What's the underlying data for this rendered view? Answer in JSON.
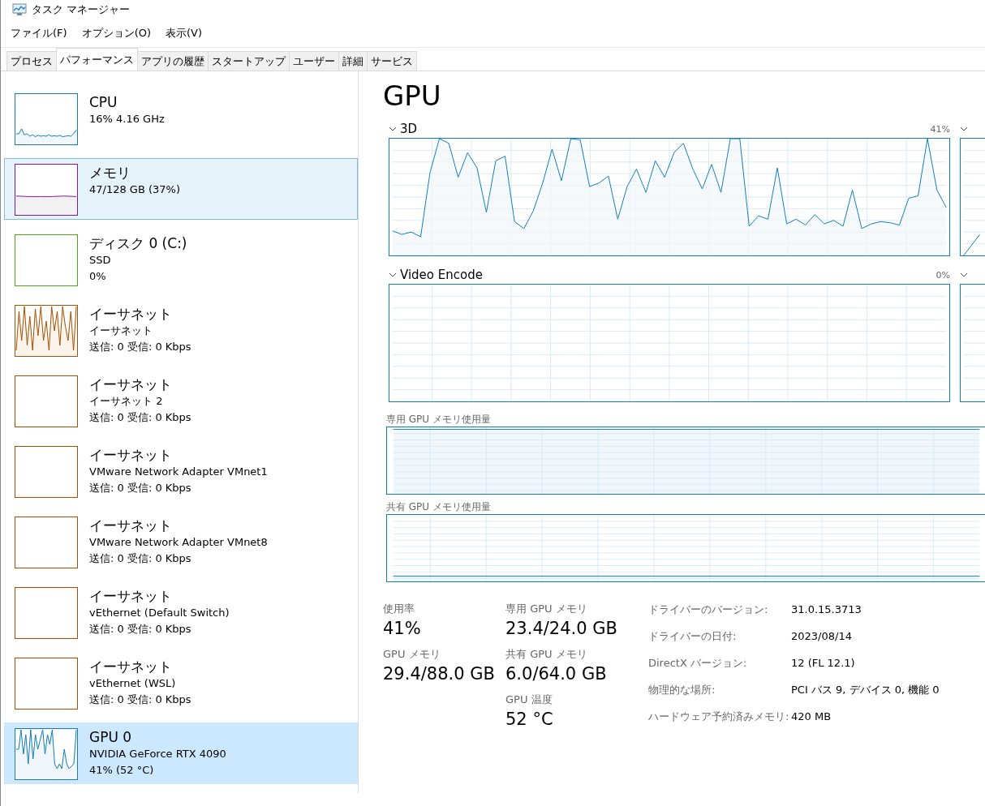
{
  "window": {
    "title": "タスク マネージャー"
  },
  "menu": [
    "ファイル(F)",
    "オプション(O)",
    "表示(V)"
  ],
  "tabs": [
    {
      "label": "プロセス",
      "selected": false
    },
    {
      "label": "パフォーマンス",
      "selected": true
    },
    {
      "label": "アプリの履歴",
      "selected": false
    },
    {
      "label": "スタートアップ",
      "selected": false
    },
    {
      "label": "ユーザー",
      "selected": false
    },
    {
      "label": "詳細",
      "selected": false
    },
    {
      "label": "サービス",
      "selected": false
    }
  ],
  "sidebar": {
    "items": [
      {
        "kind": "cpu",
        "color": "#117dbb",
        "title": "CPU",
        "lines": [
          "16% 4.16 GHz"
        ],
        "selected": false,
        "hovered": false
      },
      {
        "kind": "memory",
        "color": "#8b12ae",
        "title": "メモリ",
        "lines": [
          "47/128 GB (37%)"
        ],
        "selected": false,
        "hovered": true
      },
      {
        "kind": "disk",
        "color": "#4da60c",
        "title": "ディスク 0 (C:)",
        "lines": [
          "SSD",
          "0%"
        ],
        "selected": false,
        "hovered": false
      },
      {
        "kind": "network-busy",
        "color": "#a74f01",
        "title": "イーサネット",
        "lines": [
          "イーサネット",
          "送信: 0 受信: 0 Kbps"
        ],
        "selected": false,
        "hovered": false
      },
      {
        "kind": "network",
        "color": "#a74f01",
        "title": "イーサネット",
        "lines": [
          "イーサネット 2",
          "送信: 0 受信: 0 Kbps"
        ],
        "selected": false,
        "hovered": false
      },
      {
        "kind": "network",
        "color": "#a74f01",
        "title": "イーサネット",
        "lines": [
          "VMware Network Adapter VMnet1",
          "送信: 0 受信: 0 Kbps"
        ],
        "selected": false,
        "hovered": false
      },
      {
        "kind": "network",
        "color": "#a74f01",
        "title": "イーサネット",
        "lines": [
          "VMware Network Adapter VMnet8",
          "送信: 0 受信: 0 Kbps"
        ],
        "selected": false,
        "hovered": false
      },
      {
        "kind": "network",
        "color": "#a74f01",
        "title": "イーサネット",
        "lines": [
          "vEthernet (Default Switch)",
          "送信: 0 受信: 0 Kbps"
        ],
        "selected": false,
        "hovered": false
      },
      {
        "kind": "network",
        "color": "#a74f01",
        "title": "イーサネット",
        "lines": [
          "vEthernet (WSL)",
          "送信: 0 受信: 0 Kbps"
        ],
        "selected": false,
        "hovered": false
      },
      {
        "kind": "gpu",
        "color": "#117dbb",
        "title": "GPU 0",
        "lines": [
          "NVIDIA GeForce RTX 4090",
          "41% (52 °C)"
        ],
        "selected": true,
        "hovered": false
      }
    ]
  },
  "panel": {
    "title": "GPU",
    "engine_graphs": [
      {
        "kind": "render",
        "label": "3D",
        "reading": "41%"
      },
      {
        "kind": "idle",
        "label": "Video Encode",
        "reading": "0%"
      }
    ],
    "memory_graphs": [
      {
        "kind": "dedicated",
        "label": "専用 GPU メモリ使用量"
      },
      {
        "kind": "shared",
        "label": "共有 GPU メモリ使用量"
      }
    ],
    "stat_columns": [
      [
        {
          "label": "使用率",
          "value": "41%"
        },
        {
          "label": "GPU メモリ",
          "value": "29.4/88.0 GB"
        }
      ],
      [
        {
          "label": "専用 GPU メモリ",
          "value": "23.4/24.0 GB"
        },
        {
          "label": "共有 GPU メモリ",
          "value": "6.0/64.0 GB"
        },
        {
          "label": "GPU 温度",
          "value": "52 °C"
        }
      ]
    ],
    "details": [
      {
        "label": "ドライバーのバージョン:",
        "value": "31.0.15.3713"
      },
      {
        "label": "ドライバーの日付:",
        "value": "2023/08/14"
      },
      {
        "label": "DirectX バージョン:",
        "value": "12 (FL 12.1)"
      },
      {
        "label": "物理的な場所:",
        "value": "PCI バス 9, デバイス 0, 機能 0"
      },
      {
        "label": "ハードウェア予約済みメモリ:",
        "value": "420 MB"
      }
    ]
  }
}
